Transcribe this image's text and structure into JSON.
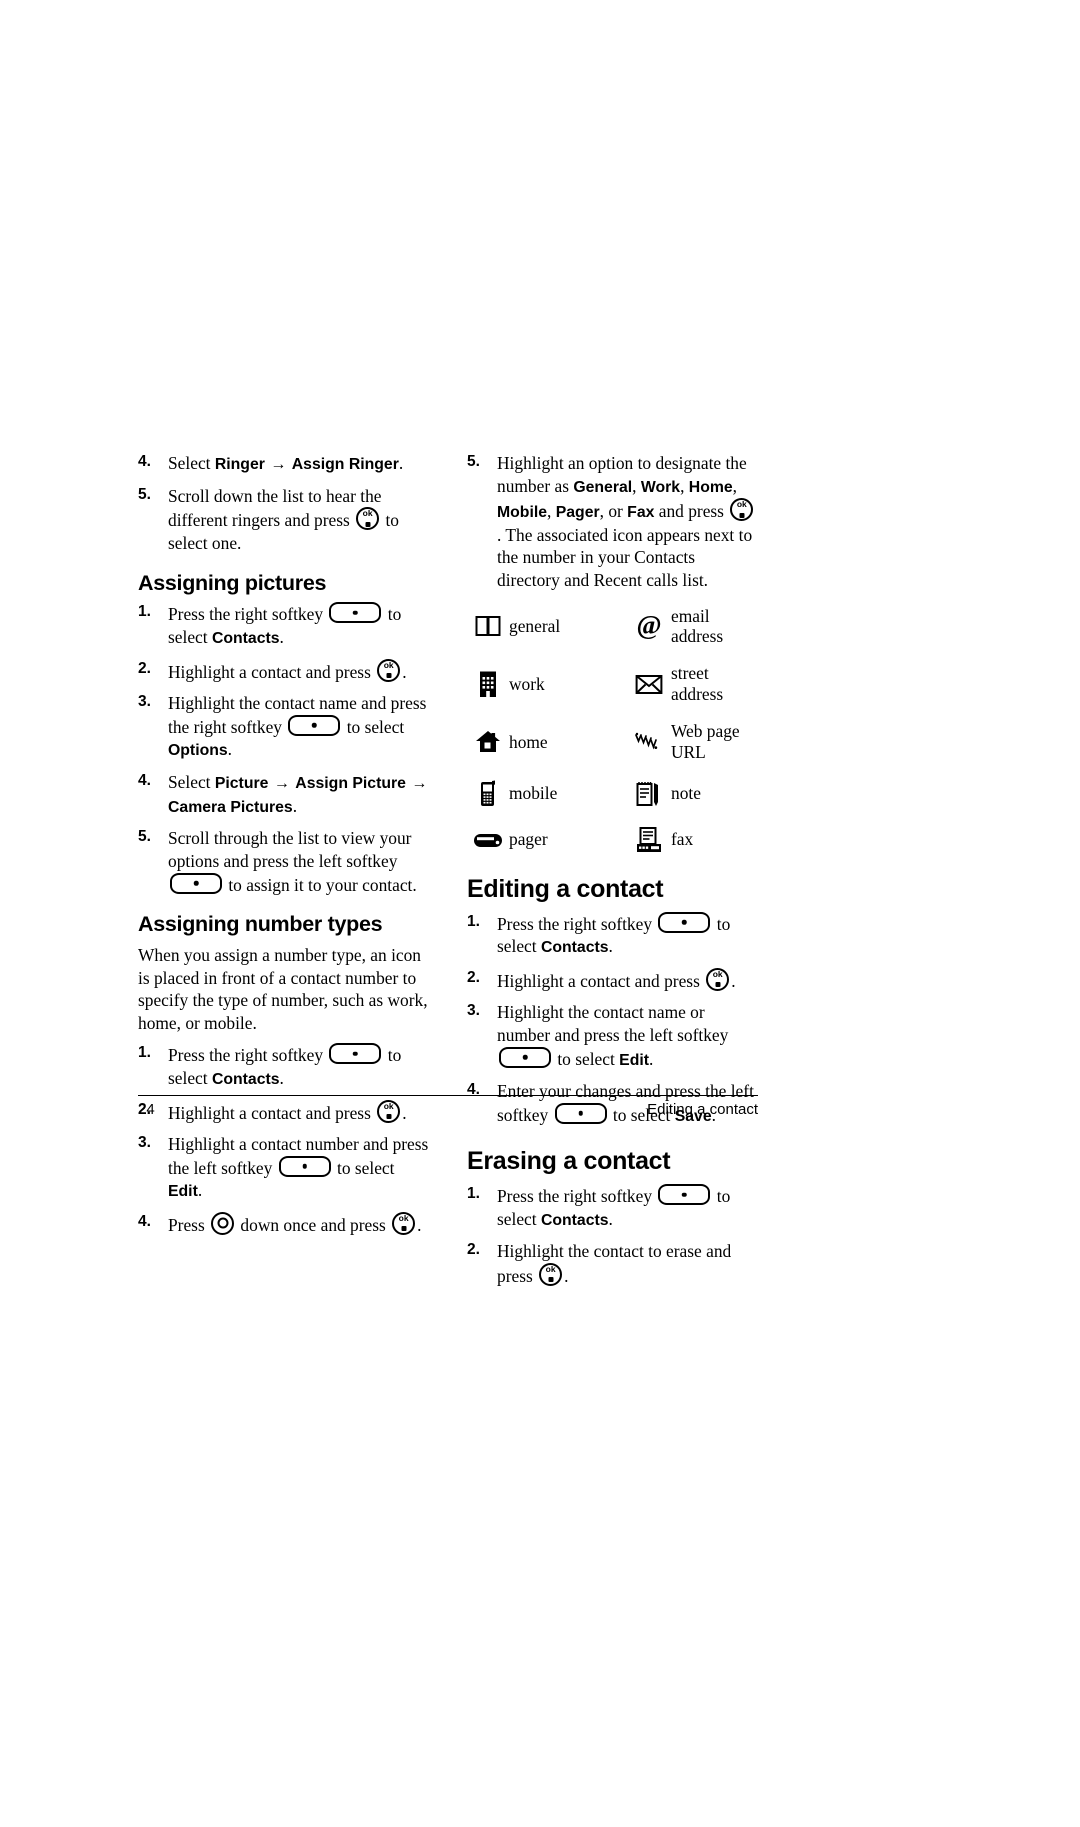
{
  "page": {
    "number": "24",
    "footer_title": "Editing a contact"
  },
  "left_column": {
    "continued_steps": [
      {
        "num": "4.",
        "parts": [
          {
            "t": "text",
            "v": "Select "
          },
          {
            "t": "ui",
            "v": "Ringer"
          },
          {
            "t": "arrow",
            "v": "→"
          },
          {
            "t": "ui",
            "v": "Assign Ringer"
          },
          {
            "t": "text",
            "v": "."
          }
        ]
      },
      {
        "num": "5.",
        "parts": [
          {
            "t": "text",
            "v": "Scroll down the list to hear the different ringers and press "
          },
          {
            "t": "okkey",
            "v": "ok-key"
          },
          {
            "t": "text",
            "v": " to select one."
          }
        ]
      }
    ],
    "sections": [
      {
        "heading": "Assigning pictures",
        "intro": null,
        "steps": [
          {
            "num": "1.",
            "parts": [
              {
                "t": "text",
                "v": "Press the right softkey "
              },
              {
                "t": "softkey",
                "v": "softkey"
              },
              {
                "t": "text",
                "v": " to select "
              },
              {
                "t": "ui",
                "v": "Contacts"
              },
              {
                "t": "text",
                "v": "."
              }
            ]
          },
          {
            "num": "2.",
            "parts": [
              {
                "t": "text",
                "v": "Highlight a contact and press "
              },
              {
                "t": "okkey",
                "v": "ok-key"
              },
              {
                "t": "text",
                "v": "."
              }
            ]
          },
          {
            "num": "3.",
            "parts": [
              {
                "t": "text",
                "v": "Highlight the contact name and press the right softkey "
              },
              {
                "t": "softkey",
                "v": "softkey"
              },
              {
                "t": "text",
                "v": " to select "
              },
              {
                "t": "ui",
                "v": "Options"
              },
              {
                "t": "text",
                "v": "."
              }
            ]
          },
          {
            "num": "4.",
            "parts": [
              {
                "t": "text",
                "v": "Select "
              },
              {
                "t": "ui",
                "v": "Picture"
              },
              {
                "t": "arrow",
                "v": "→"
              },
              {
                "t": "ui",
                "v": "Assign Picture"
              },
              {
                "t": "arrow",
                "v": "→"
              },
              {
                "t": "ui",
                "v": "Camera Pictures"
              },
              {
                "t": "text",
                "v": "."
              }
            ]
          },
          {
            "num": "5.",
            "parts": [
              {
                "t": "text",
                "v": "Scroll through the list to view your options and press the left softkey "
              },
              {
                "t": "softkey",
                "v": "softkey"
              },
              {
                "t": "text",
                "v": " to assign it to your contact."
              }
            ]
          }
        ]
      },
      {
        "heading": "Assigning number types",
        "intro": "When you assign a number type, an icon is placed in front of a contact number to specify the type of number, such as work, home, or mobile.",
        "steps": [
          {
            "num": "1.",
            "parts": [
              {
                "t": "text",
                "v": "Press the right softkey "
              },
              {
                "t": "softkey",
                "v": "softkey"
              },
              {
                "t": "text",
                "v": " to select "
              },
              {
                "t": "ui",
                "v": "Contacts"
              },
              {
                "t": "text",
                "v": "."
              }
            ]
          },
          {
            "num": "2.",
            "parts": [
              {
                "t": "text",
                "v": "Highlight a contact and press "
              },
              {
                "t": "okkey",
                "v": "ok-key"
              },
              {
                "t": "text",
                "v": "."
              }
            ]
          },
          {
            "num": "3.",
            "parts": [
              {
                "t": "text",
                "v": "Highlight a contact number and press the left softkey "
              },
              {
                "t": "softkey",
                "v": "softkey"
              },
              {
                "t": "text",
                "v": " to select "
              },
              {
                "t": "ui",
                "v": "Edit"
              },
              {
                "t": "text",
                "v": "."
              }
            ]
          },
          {
            "num": "4.",
            "parts": [
              {
                "t": "text",
                "v": "Press "
              },
              {
                "t": "navkey",
                "v": "nav-key"
              },
              {
                "t": "text",
                "v": " down once and press "
              },
              {
                "t": "okkey",
                "v": "ok-key"
              },
              {
                "t": "text",
                "v": "."
              }
            ]
          }
        ]
      }
    ]
  },
  "right_column": {
    "continued_steps": [
      {
        "num": "5.",
        "parts": [
          {
            "t": "text",
            "v": "Highlight an option to designate the number as "
          },
          {
            "t": "ui",
            "v": "General"
          },
          {
            "t": "text",
            "v": ", "
          },
          {
            "t": "ui",
            "v": "Work"
          },
          {
            "t": "text",
            "v": ", "
          },
          {
            "t": "ui",
            "v": "Home"
          },
          {
            "t": "text",
            "v": ", "
          },
          {
            "t": "ui",
            "v": "Mobile"
          },
          {
            "t": "text",
            "v": ", "
          },
          {
            "t": "ui",
            "v": "Pager"
          },
          {
            "t": "text",
            "v": ", or "
          },
          {
            "t": "ui",
            "v": "Fax"
          },
          {
            "t": "text",
            "v": " and press "
          },
          {
            "t": "okkey",
            "v": "ok-key"
          },
          {
            "t": "text",
            "v": ". The associated icon appears next to the number in your Contacts directory and Recent calls list."
          }
        ]
      }
    ],
    "icon_table": [
      {
        "left_icon": "book-icon",
        "left_label": "general",
        "right_icon": "at-sign-icon",
        "right_label": "email address"
      },
      {
        "left_icon": "office-building-icon",
        "left_label": "work",
        "right_icon": "envelope-icon",
        "right_label": "street address"
      },
      {
        "left_icon": "house-icon",
        "left_label": "home",
        "right_icon": "web-url-icon",
        "right_label": "Web page URL"
      },
      {
        "left_icon": "mobile-phone-icon",
        "left_label": "mobile",
        "right_icon": "notepad-icon",
        "right_label": "note"
      },
      {
        "left_icon": "pager-icon",
        "left_label": "pager",
        "right_icon": "fax-machine-icon",
        "right_label": "fax"
      }
    ],
    "sections": [
      {
        "heading": "Editing a contact",
        "steps": [
          {
            "num": "1.",
            "parts": [
              {
                "t": "text",
                "v": "Press the right softkey "
              },
              {
                "t": "softkey",
                "v": "softkey"
              },
              {
                "t": "text",
                "v": " to select "
              },
              {
                "t": "ui",
                "v": "Contacts"
              },
              {
                "t": "text",
                "v": "."
              }
            ]
          },
          {
            "num": "2.",
            "parts": [
              {
                "t": "text",
                "v": "Highlight a contact and press "
              },
              {
                "t": "okkey",
                "v": "ok-key"
              },
              {
                "t": "text",
                "v": "."
              }
            ]
          },
          {
            "num": "3.",
            "parts": [
              {
                "t": "text",
                "v": "Highlight the contact name or number and press the left softkey "
              },
              {
                "t": "softkey",
                "v": "softkey"
              },
              {
                "t": "text",
                "v": " to select "
              },
              {
                "t": "ui",
                "v": "Edit"
              },
              {
                "t": "text",
                "v": "."
              }
            ]
          },
          {
            "num": "4.",
            "parts": [
              {
                "t": "text",
                "v": "Enter your changes and press the left softkey "
              },
              {
                "t": "softkey",
                "v": "softkey"
              },
              {
                "t": "text",
                "v": " to select "
              },
              {
                "t": "ui",
                "v": "Save"
              },
              {
                "t": "text",
                "v": "."
              }
            ]
          }
        ]
      },
      {
        "heading": "Erasing a contact",
        "steps": [
          {
            "num": "1.",
            "parts": [
              {
                "t": "text",
                "v": "Press the right softkey "
              },
              {
                "t": "softkey",
                "v": "softkey"
              },
              {
                "t": "text",
                "v": " to select "
              },
              {
                "t": "ui",
                "v": "Contacts"
              },
              {
                "t": "text",
                "v": "."
              }
            ]
          },
          {
            "num": "2.",
            "parts": [
              {
                "t": "text",
                "v": "Highlight the contact to erase and press "
              },
              {
                "t": "okkey",
                "v": "ok-key"
              },
              {
                "t": "text",
                "v": "."
              }
            ]
          }
        ]
      }
    ]
  }
}
